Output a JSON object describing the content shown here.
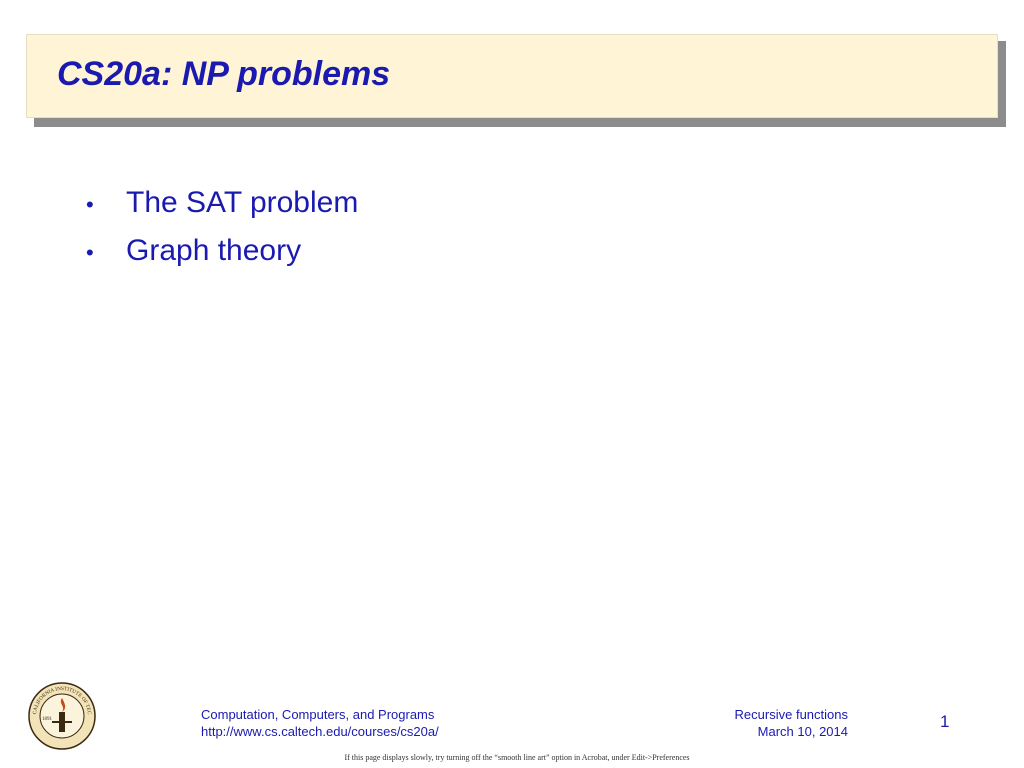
{
  "title": "CS20a: NP problems",
  "bullets": [
    {
      "label": "The SAT problem"
    },
    {
      "label": "Graph theory"
    }
  ],
  "footer": {
    "course_name": "Computation, Computers, and Programs",
    "course_url": "http://www.cs.caltech.edu/courses/cs20a/",
    "section": "Recursive functions",
    "date": "March 10, 2014",
    "page_number": "1"
  },
  "footnote": "If this page displays slowly, try turning off the “smooth line art” option in Acrobat, under Edit->Preferences",
  "logo": {
    "icon": "caltech-seal-icon",
    "text": "CALIFORNIA INSTITUTE OF TECHNOLOGY",
    "year": "1891"
  },
  "colors": {
    "accent": "#1a1ab0",
    "title_background": "#fff4d6",
    "title_shadow": "#8c8c8c"
  }
}
